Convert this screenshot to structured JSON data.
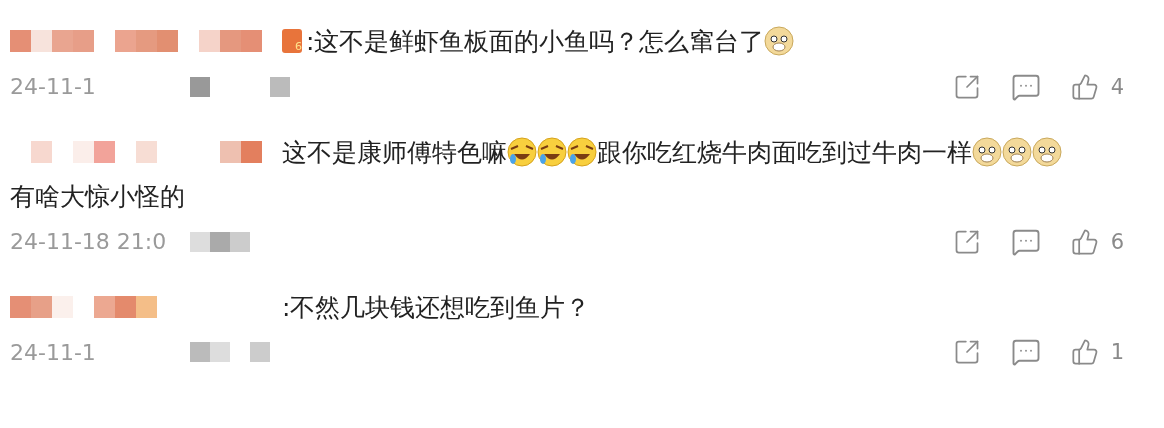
{
  "comments": [
    {
      "segments": [
        {
          "kind": "badge",
          "text": "6"
        },
        {
          "kind": "text",
          "text": ":这不是鲜虾鱼板面的小鱼吗？怎么窜台了"
        },
        {
          "kind": "doge"
        }
      ],
      "time": "24-11-1",
      "likes": "4"
    },
    {
      "segments": [
        {
          "kind": "text",
          "text": "这不是康师傅特色嘛"
        },
        {
          "kind": "laugh"
        },
        {
          "kind": "laugh"
        },
        {
          "kind": "laugh"
        },
        {
          "kind": "text",
          "text": "跟你吃红烧牛肉面吃到过牛肉一样"
        },
        {
          "kind": "doge"
        },
        {
          "kind": "doge"
        },
        {
          "kind": "doge"
        },
        {
          "kind": "text",
          "text": "有啥大惊小怪的"
        }
      ],
      "time": "24-11-18 21:0",
      "likes": "6"
    },
    {
      "segments": [
        {
          "kind": "text",
          "text": ":不然几块钱还想吃到鱼片？"
        }
      ],
      "time": "24-11-1",
      "likes": "1"
    }
  ]
}
